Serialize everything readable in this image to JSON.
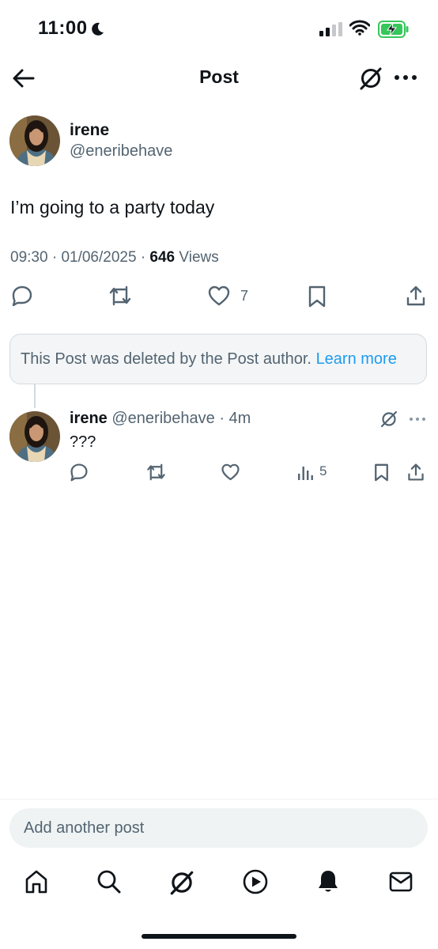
{
  "status_bar": {
    "time": "11:00"
  },
  "header": {
    "title": "Post"
  },
  "post": {
    "author_name": "irene",
    "author_handle": "@eneribehave",
    "text": "I’m going to a party today",
    "time": "09:30",
    "date": "01/06/2025",
    "views_count": "646",
    "views_label": "Views",
    "like_count": "7"
  },
  "deleted_notice": {
    "text": "This Post was deleted by the Post author.",
    "link": "Learn more"
  },
  "reply": {
    "author_name": "irene",
    "author_handle": "@eneribehave",
    "age": "4m",
    "text": "???",
    "views_count": "5"
  },
  "composer": {
    "placeholder": "Add another post"
  },
  "colors": {
    "accent": "#1d9bf0",
    "secondary_text": "#536471",
    "battery": "#35c759"
  }
}
